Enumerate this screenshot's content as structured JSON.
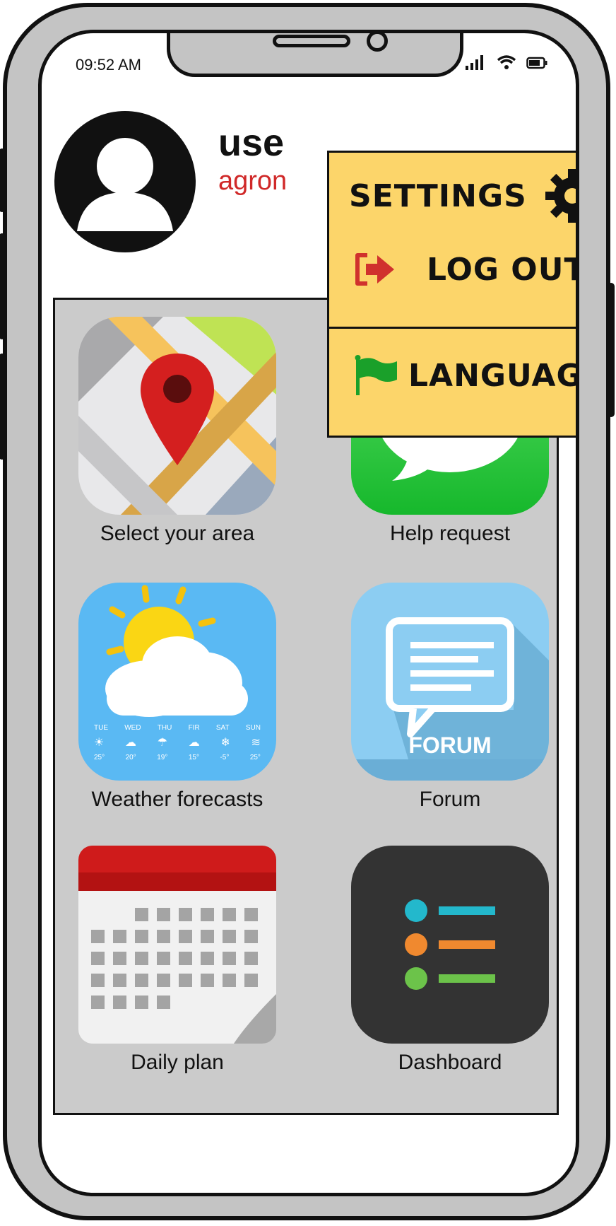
{
  "status_bar": {
    "time": "09:52 AM"
  },
  "profile": {
    "username": "use",
    "role": "agron"
  },
  "menu": {
    "settings_label": "SETTINGS",
    "logout_label": "LOG OUT",
    "language_label": "LANGUAGE"
  },
  "apps": [
    {
      "label": "Select your area",
      "icon": "map-pin-icon"
    },
    {
      "label": "Help request",
      "icon": "message-bubble-icon"
    },
    {
      "label": "Weather forecasts",
      "icon": "weather-icon"
    },
    {
      "label": "Forum",
      "icon": "forum-icon"
    },
    {
      "label": "Daily plan",
      "icon": "calendar-icon"
    },
    {
      "label": "Dashboard",
      "icon": "dashboard-list-icon"
    }
  ],
  "weather_days": [
    "TUE",
    "WED",
    "THU",
    "FIR",
    "SAT",
    "SUN"
  ],
  "weather_temps": [
    "25°",
    "20°",
    "19°",
    "15°",
    "-5°",
    "25°"
  ],
  "forum_caption": "FORUM",
  "colors": {
    "menu_bg": "#fcd56a",
    "logout_icon": "#d0312d",
    "language_flag": "#1aa02a",
    "role_text": "#d02828"
  }
}
